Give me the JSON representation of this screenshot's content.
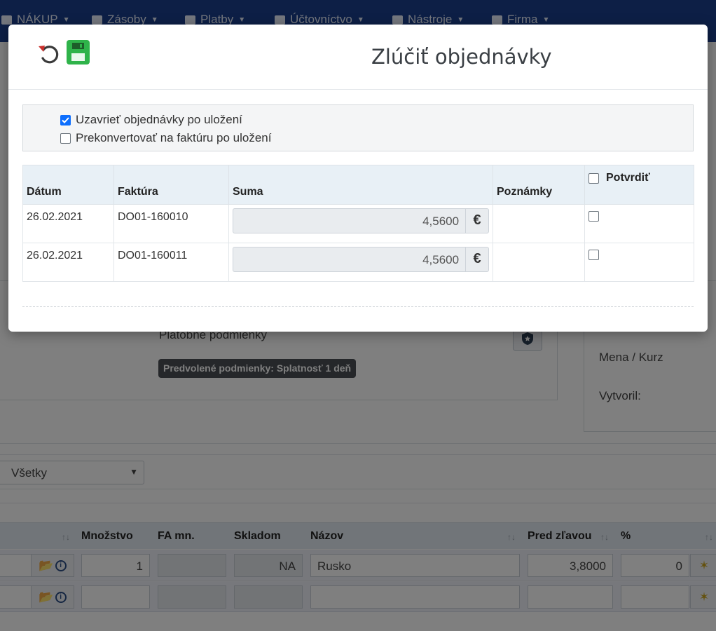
{
  "navbar": {
    "items": [
      {
        "label": "NÁKUP",
        "icon": "cart-icon"
      },
      {
        "label": "Zásoby",
        "icon": "boxes-icon"
      },
      {
        "label": "Platby",
        "icon": "money-icon"
      },
      {
        "label": "Účtovníctvo",
        "icon": "book-icon"
      },
      {
        "label": "Nástroje",
        "icon": "wrench-icon"
      },
      {
        "label": "Firma",
        "icon": "gear-icon"
      }
    ]
  },
  "background": {
    "payment_terms_label": "Platobné podmienky",
    "default_terms_badge": "Predvolené podmienky: Splatnosť 1 deň",
    "currency_label": "Mena / Kurz",
    "created_by_label": "Vytvoril:",
    "filter_select_value": "Všetky",
    "grid": {
      "headers": [
        "Množstvo",
        "FA mn.",
        "Skladom",
        "Názov",
        "Pred zľavou",
        "%"
      ],
      "rows": [
        {
          "quantity": "1",
          "fa_qty": "",
          "stock": "NA",
          "name": "Rusko",
          "before_discount": "3,8000",
          "percent": "0"
        },
        {
          "quantity": "",
          "fa_qty": "",
          "stock": "",
          "name": "",
          "before_discount": "",
          "percent": ""
        }
      ]
    }
  },
  "modal": {
    "title": "Zlúčiť objednávky",
    "options": [
      {
        "label": "Uzavrieť objednávky po uložení",
        "checked": true
      },
      {
        "label": "Prekonvertovať na faktúru po uložení",
        "checked": false
      }
    ],
    "table": {
      "headers": {
        "date": "Dátum",
        "invoice": "Faktúra",
        "sum": "Suma",
        "notes": "Poznámky",
        "confirm": "Potvrdiť"
      },
      "rows": [
        {
          "date": "26.02.2021",
          "invoice": "DO01-160010",
          "sum": "4,5600",
          "currency": "€",
          "notes": "",
          "confirmed": false
        },
        {
          "date": "26.02.2021",
          "invoice": "DO01-160011",
          "sum": "4,5600",
          "currency": "€",
          "notes": "",
          "confirmed": false
        }
      ]
    }
  },
  "colors": {
    "navbar": "#1b3f8c",
    "save_button": "#2fb34a",
    "undo_icon": "#c9302c",
    "checkbox_checked": "#0d6efd"
  }
}
